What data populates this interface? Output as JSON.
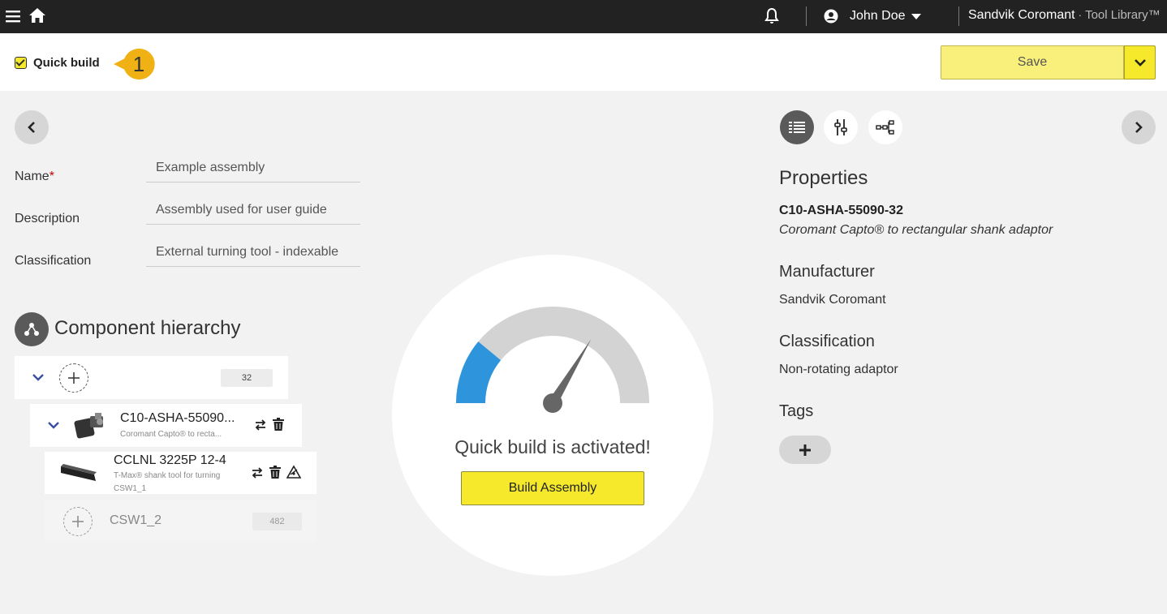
{
  "topbar": {
    "user_name": "John Doe",
    "brand_name": "Sandvik Coromant",
    "brand_sep": " · ",
    "brand_product": "Tool Library™"
  },
  "actionbar": {
    "quick_build_label": "Quick build",
    "quick_build_checked": true,
    "step_number": "1",
    "save_label": "Save"
  },
  "form": {
    "name_label": "Name",
    "name_required_mark": "*",
    "name_value": "Example assembly",
    "description_label": "Description",
    "description_value": "Assembly used for user guide",
    "classification_label": "Classification",
    "classification_value": "External turning tool - indexable"
  },
  "hierarchy": {
    "title": "Component hierarchy",
    "root_badge": "32",
    "items": [
      {
        "name": "C10-ASHA-55090...",
        "sub": "Coromant Capto® to recta..."
      },
      {
        "name": "CCLNL 3225P 12-4",
        "sub": "T-Max® shank tool for turning",
        "sub2": "CSW1_1"
      }
    ],
    "slot": {
      "name": "CSW1_2",
      "badge": "482"
    }
  },
  "center": {
    "message": "Quick build is activated!",
    "build_label": "Build Assembly",
    "gauge_level": 0.22
  },
  "properties": {
    "title": "Properties",
    "code": "C10-ASHA-55090-32",
    "description": "Coromant Capto® to rectangular shank adaptor",
    "manufacturer_heading": "Manufacturer",
    "manufacturer": "Sandvik Coromant",
    "classification_heading": "Classification",
    "classification": "Non-rotating adaptor",
    "tags_heading": "Tags"
  },
  "colors": {
    "accent_yellow": "#f6e92b",
    "gauge_blue": "#2e95dc",
    "topbar": "#222222"
  }
}
